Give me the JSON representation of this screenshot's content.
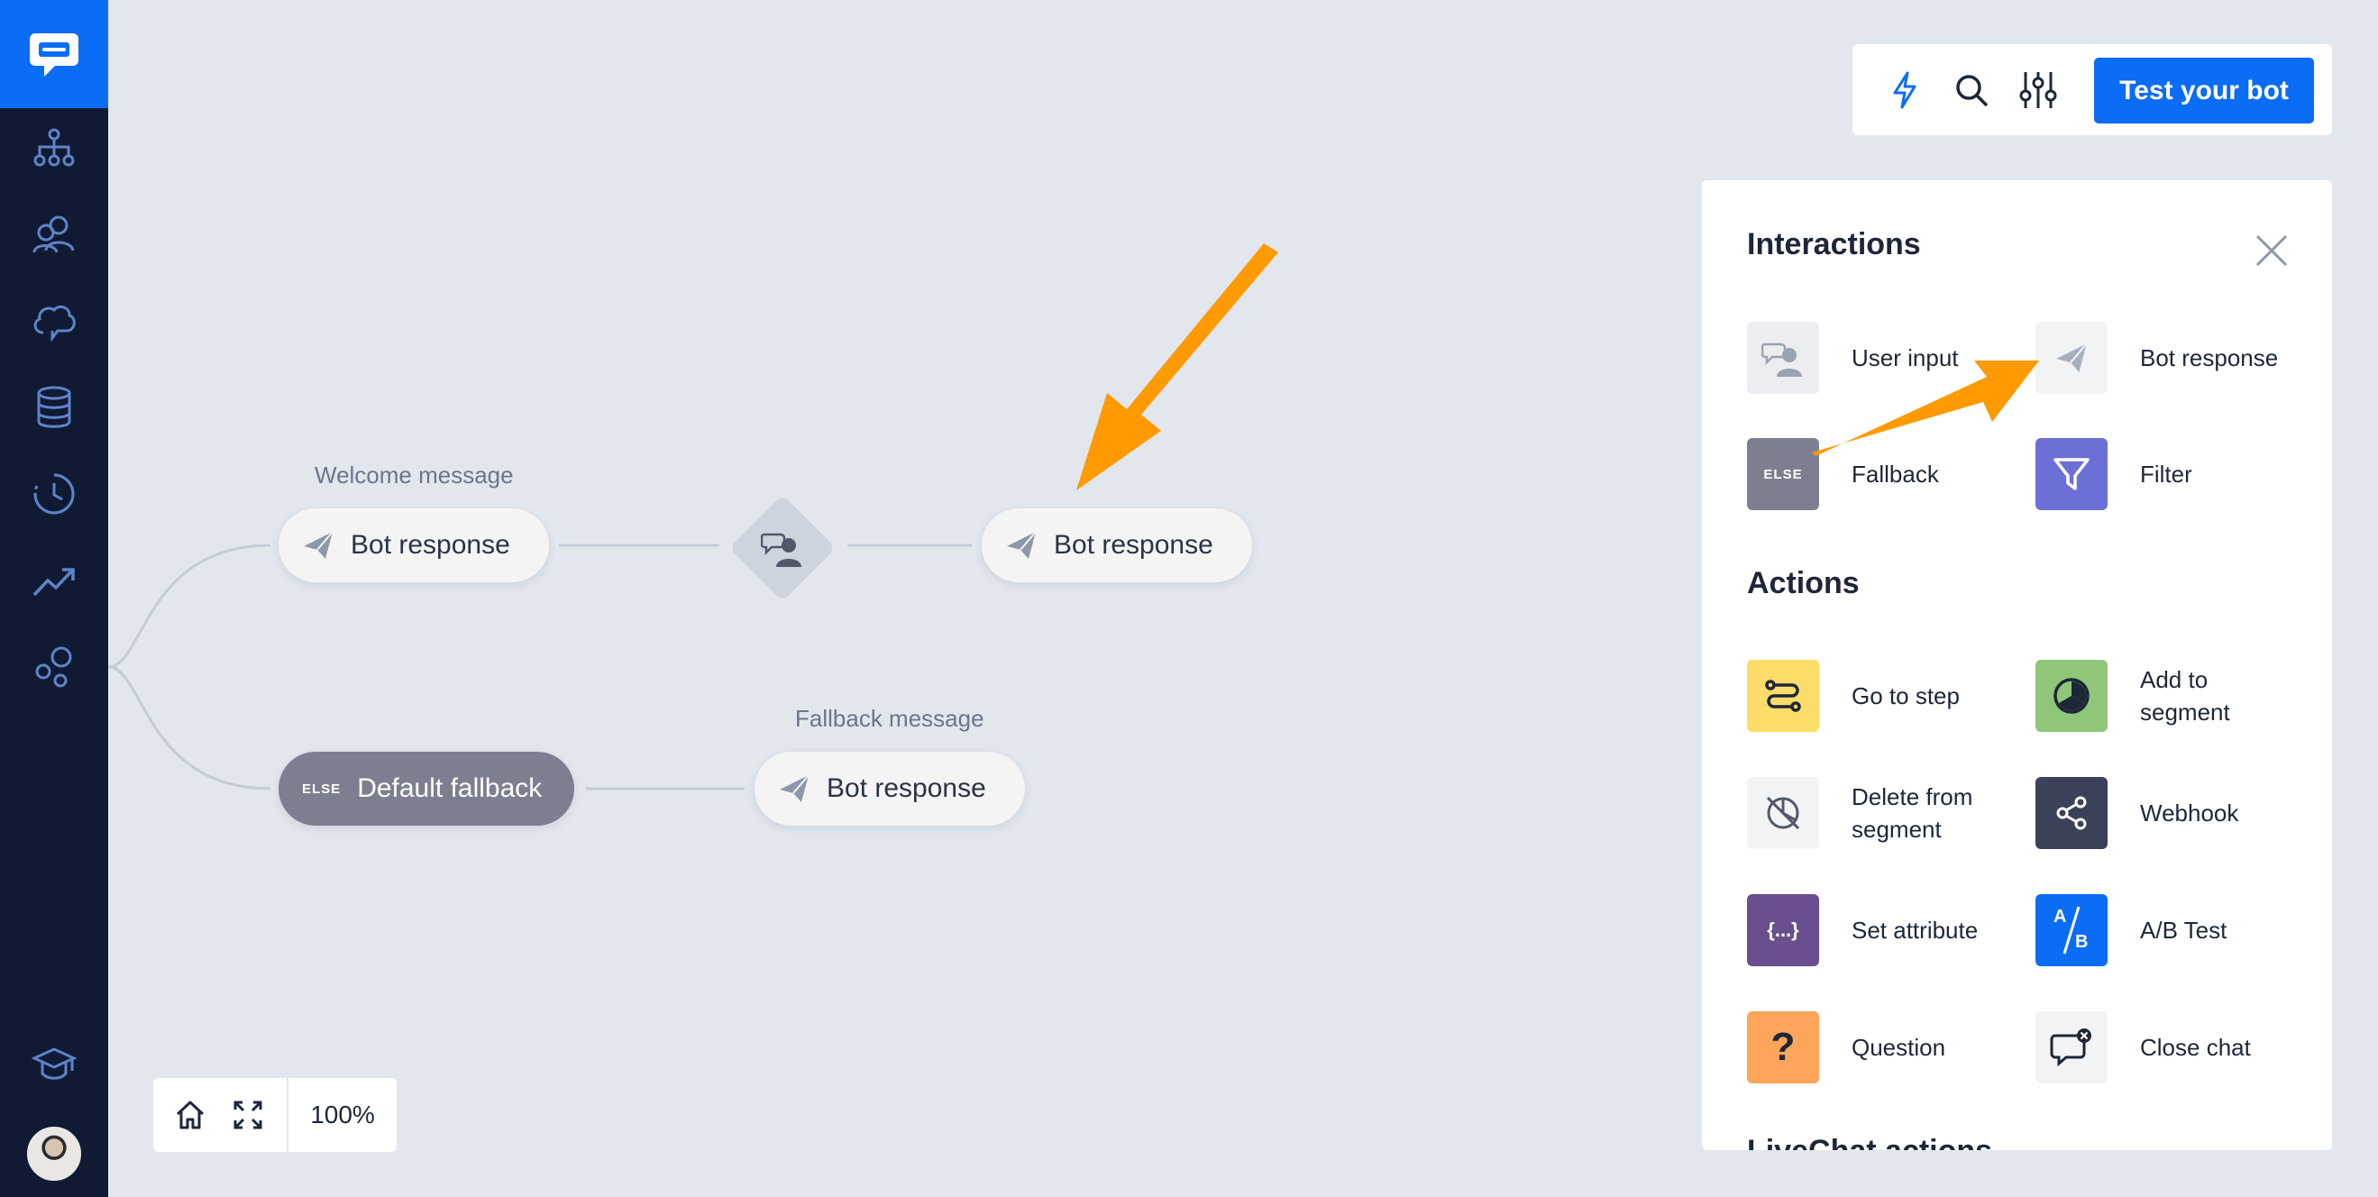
{
  "sidebar": {
    "logo_icon": "chat-bubble-logo-icon",
    "items": [
      {
        "name": "sidebar-item-stories",
        "icon": "sitemap-icon"
      },
      {
        "name": "sidebar-item-users",
        "icon": "users-icon"
      },
      {
        "name": "sidebar-item-training",
        "icon": "brain-cloud-icon"
      },
      {
        "name": "sidebar-item-data",
        "icon": "database-icon"
      },
      {
        "name": "sidebar-item-history",
        "icon": "history-clock-icon"
      },
      {
        "name": "sidebar-item-reports",
        "icon": "trend-chart-icon"
      },
      {
        "name": "sidebar-item-integrations",
        "icon": "bubbles-icon"
      }
    ],
    "bottom_icon": "graduation-cap-icon"
  },
  "canvas": {
    "welcome_caption": "Welcome message",
    "welcome_node": "Bot response",
    "second_node": "Bot response",
    "fallback_caption": "Fallback message",
    "fallback_node": "Bot response",
    "default_fallback_tag": "ELSE",
    "default_fallback_label": "Default fallback"
  },
  "toolbar": {
    "test_button": "Test your bot"
  },
  "panel": {
    "interactions_title": "Interactions",
    "interactions": [
      {
        "label": "User input",
        "icon": "user-input-icon"
      },
      {
        "label": "Bot response",
        "icon": "paper-plane-icon"
      },
      {
        "label": "Fallback",
        "icon": "else-icon",
        "tag": "ELSE"
      },
      {
        "label": "Filter",
        "icon": "filter-icon"
      }
    ],
    "actions_title": "Actions",
    "actions": [
      {
        "label": "Go to step",
        "icon": "route-icon"
      },
      {
        "label": "Add to\nsegment",
        "icon": "pie-segment-icon"
      },
      {
        "label": "Delete from\nsegment",
        "icon": "segment-off-icon"
      },
      {
        "label": "Webhook",
        "icon": "share-nodes-icon"
      },
      {
        "label": "Set attribute",
        "icon": "braces-icon",
        "tag": "{...}"
      },
      {
        "label": "A/B Test",
        "icon": "ab-test-icon",
        "tag_a": "A",
        "tag_b": "B"
      },
      {
        "label": "Question",
        "icon": "question-icon",
        "tag": "?"
      },
      {
        "label": "Close chat",
        "icon": "close-chat-icon"
      }
    ],
    "next_section_title": "LiveChat actions"
  },
  "zoom": {
    "value": "100%"
  },
  "colors": {
    "accent": "#0b6cf5",
    "sidebar": "#101a33",
    "annotation_arrow": "#ff9a00"
  }
}
